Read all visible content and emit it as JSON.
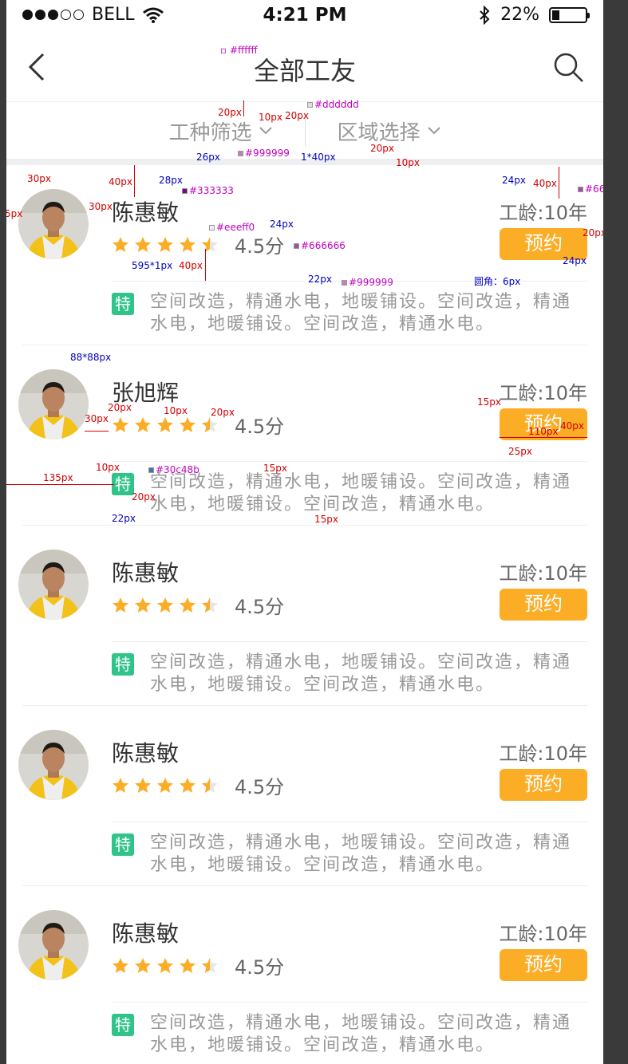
{
  "status_bar": {
    "carrier": "BELL",
    "time": "4:21 PM",
    "battery": "22%"
  },
  "nav": {
    "title": "全部工友"
  },
  "filter": {
    "option1": "工种筛选",
    "option2": "区域选择"
  },
  "workers": [
    {
      "name": "陈惠敏",
      "score": "4.5分",
      "rating": 4.5,
      "years": "工龄:10年",
      "book_label": "预约",
      "tag": "特",
      "desc": "空间改造，精通水电，地暖铺设。空间改造，精通水电，地暖铺设。空间改造，精通水电。"
    },
    {
      "name": "张旭辉",
      "score": "4.5分",
      "rating": 4.5,
      "years": "工龄:10年",
      "book_label": "预约",
      "tag": "特",
      "desc": "空间改造，精通水电，地暖铺设。空间改造，精通水电，地暖铺设。空间改造，精通水电。"
    },
    {
      "name": "陈惠敏",
      "score": "4.5分",
      "rating": 4.5,
      "years": "工龄:10年",
      "book_label": "预约",
      "tag": "特",
      "desc": "空间改造，精通水电，地暖铺设。空间改造，精通水电，地暖铺设。空间改造，精通水电。"
    },
    {
      "name": "陈惠敏",
      "score": "4.5分",
      "rating": 4.5,
      "years": "工龄:10年",
      "book_label": "预约",
      "tag": "特",
      "desc": "空间改造，精通水电，地暖铺设。空间改造，精通水电，地暖铺设。空间改造，精通水电。"
    },
    {
      "name": "陈惠敏",
      "score": "4.5分",
      "rating": 4.5,
      "years": "工龄:10年",
      "book_label": "预约",
      "tag": "特",
      "desc": "空间改造，精通水电，地暖铺设。空间改造，精通水电，地暖铺设。空间改造，精通水电。"
    }
  ],
  "colors": {
    "star": "#fcad26",
    "button": "#fcad26",
    "tag": "#30c48b",
    "title": "#333333",
    "secondary": "#666666",
    "muted": "#999999",
    "divider": "#eeeeee",
    "bar": "#eeeff0"
  },
  "annotations": {
    "white": "#ffffff",
    "c999": "#999999",
    "cddd": "#dddddd",
    "c333": "#333333",
    "c666": "#666666",
    "c666b": "#666666",
    "c666c": "#666666",
    "ceee": "#eeeff0",
    "c999b": "#999999",
    "green": "#30c48b",
    "px20a": "20px",
    "px10a": "10px",
    "px20b": "20px",
    "px26": "26px",
    "line1x40": "1*40px",
    "px20c": "20px",
    "px10b": "10px",
    "px30a": "30px",
    "px40a": "40px",
    "px28": "28px",
    "px30b": "30px",
    "px5": "5px",
    "px24a": "24px",
    "px40b": "40px",
    "px20d": "20px",
    "px24b": "24px",
    "px24c": "24px",
    "size595": "595*1px",
    "px40c": "40px",
    "px22a": "22px",
    "radius": "圆角：6px",
    "size88": "88*88px",
    "px15a": "15px",
    "px20e": "20px",
    "px10c": "10px",
    "px20f": "20px",
    "px30c": "30px",
    "px110": "110px",
    "px40d": "40px",
    "px25": "25px",
    "px10d": "10px",
    "px135": "135px",
    "px15b": "15px",
    "px20g": "20px",
    "px22b": "22px",
    "px15c": "15px"
  }
}
